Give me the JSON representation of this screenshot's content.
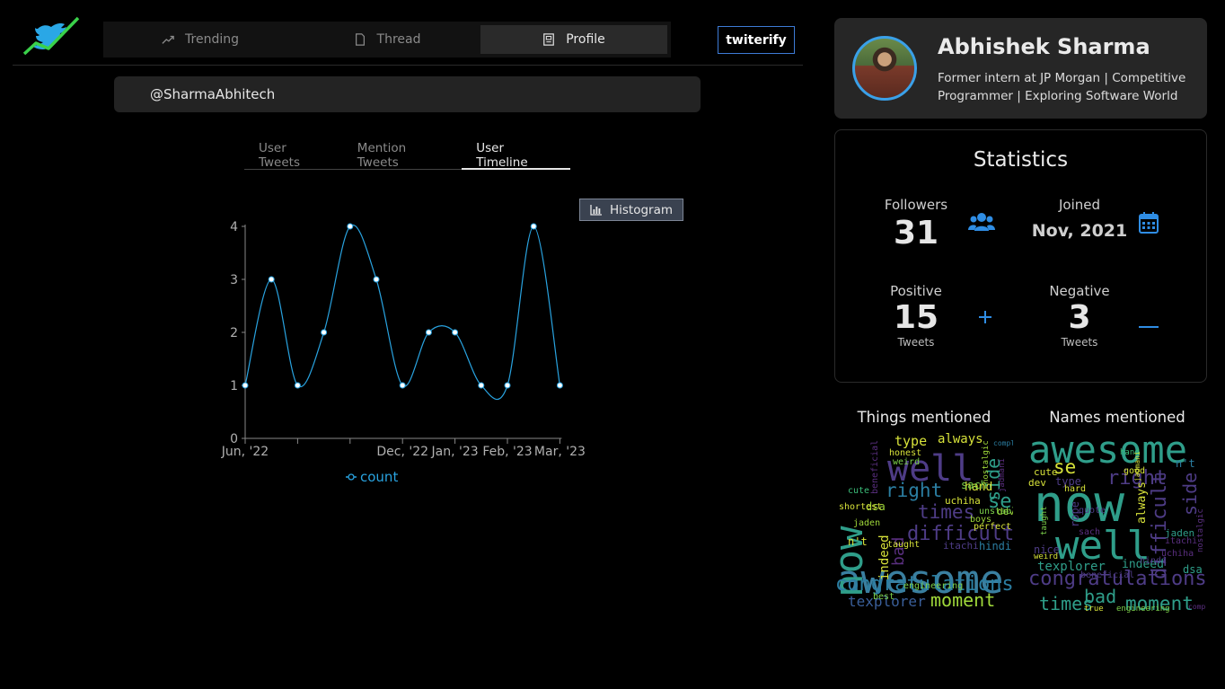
{
  "nav": {
    "tabs": [
      {
        "label": "Trending",
        "icon": "trending-icon"
      },
      {
        "label": "Thread",
        "icon": "document-icon"
      },
      {
        "label": "Profile",
        "icon": "profile-card-icon"
      }
    ],
    "active": "Profile",
    "brand_button": "twiterify"
  },
  "search": {
    "handle": "@SharmaAbhitech"
  },
  "subtabs": [
    "User Tweets",
    "Mention Tweets",
    "User Timeline"
  ],
  "histogram_button": "Histogram",
  "chart_data": {
    "type": "line",
    "series": [
      {
        "name": "count",
        "values": [
          1,
          3,
          1,
          2,
          4,
          3,
          1,
          2,
          2,
          1,
          1,
          4,
          1
        ]
      }
    ],
    "x_tick_labels": [
      "Jun, '22",
      "Dec, '22",
      "Jan, '23",
      "Feb, '23",
      "Mar, '23"
    ],
    "y_ticks": [
      0,
      1,
      2,
      3,
      4
    ],
    "ylim": [
      0,
      4
    ],
    "line_color": "#29a3e0"
  },
  "profile": {
    "name": "Abhishek Sharma",
    "bio": "Former intern at JP Morgan | Competitive Programmer | Exploring Software World"
  },
  "stats": {
    "title": "Statistics",
    "followers_label": "Followers",
    "followers_value": "31",
    "joined_label": "Joined",
    "joined_value": "Nov, 2021",
    "positive_label": "Positive",
    "positive_value": "15",
    "positive_sub": "Tweets",
    "negative_label": "Negative",
    "negative_value": "3",
    "negative_sub": "Tweets",
    "icon_color": "#2f8de4"
  },
  "wordclouds": {
    "things_title": "Things mentioned",
    "names_title": "Names mentioned",
    "things_words": [
      "awesome",
      "now",
      "well",
      "congratulations",
      "difficult",
      "moment",
      "right",
      "times",
      "bad",
      "texplorer",
      "side",
      "se",
      "type",
      "always",
      "hand",
      "indeed",
      "dsa",
      "uchiha",
      "itachi",
      "hindi",
      "sach",
      "dev",
      "unstable",
      "boys",
      "perfect",
      "shortest",
      "honest",
      "weird",
      "cute",
      "jaden",
      "taught",
      "best",
      "engineering",
      "n't",
      "complete",
      "beneficial",
      "jadmani",
      "nostalgic"
    ],
    "names_words": [
      "awesome",
      "now",
      "well",
      "congratulations",
      "difficult",
      "moment",
      "right",
      "times",
      "bad",
      "side",
      "se",
      "type",
      "always",
      "texplorer",
      "indeed",
      "dsa",
      "uchiha",
      "jaden",
      "hindi",
      "beneficial",
      "itachi",
      "sach",
      "nice",
      "cute",
      "dev",
      "weird",
      "hard",
      "rope",
      "quote",
      "taught",
      "good",
      "true",
      "engineering",
      "n't",
      "hand",
      "jadmani",
      "nostalgic",
      "complete"
    ]
  }
}
